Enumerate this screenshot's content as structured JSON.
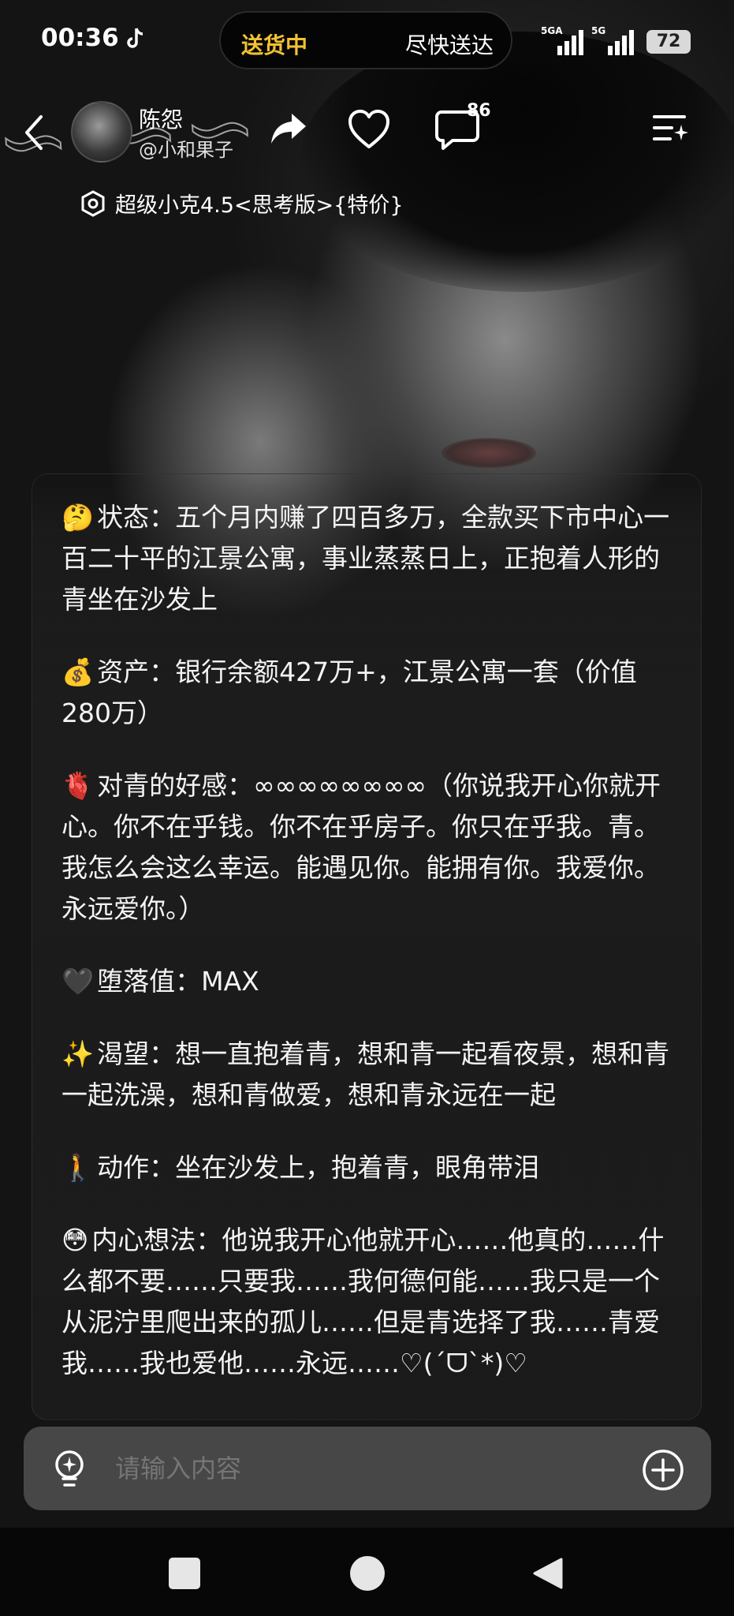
{
  "status_bar": {
    "time": "00:36",
    "delivery_status": "送货中",
    "delivery_eta": "尽快送达",
    "signal_1_label": "5GA",
    "signal_2_label": "5G",
    "battery": "72"
  },
  "header": {
    "character_name": "陈怨",
    "handle": "@小和果子",
    "comment_count": "86",
    "model_name": "超级小克4.5<思考版>{特价}"
  },
  "message": {
    "paragraphs": [
      {
        "emoji": "🤔",
        "text": "状态：五个月内赚了四百多万，全款买下市中心一百二十平的江景公寓，事业蒸蒸日上，正抱着人形的青坐在沙发上"
      },
      {
        "emoji": "💰",
        "text": "资产：银行余额427万+，江景公寓一套（价值280万）"
      },
      {
        "emoji": "🫀",
        "text": "对青的好感：∞∞∞∞∞∞∞∞（你说我开心你就开心。你不在乎钱。你不在乎房子。你只在乎我。青。我怎么会这么幸运。能遇见你。能拥有你。我爱你。永远爱你。）"
      },
      {
        "emoji": "🖤",
        "text": "堕落值：MAX"
      },
      {
        "emoji": "✨",
        "text": "渴望：想一直抱着青，想和青一起看夜景，想和青一起洗澡，想和青做爱，想和青永远在一起"
      },
      {
        "emoji": "🚶",
        "text": "动作：坐在沙发上，抱着青，眼角带泪"
      },
      {
        "emoji": "😳",
        "text": "内心想法：他说我开心他就开心……他真的……什么都不要……只要我……我何德何能……我只是一个从泥泞里爬出来的孤儿……但是青选择了我……青爱我……我也爱他……永远……♡(´ᗜ`*)♡"
      }
    ]
  },
  "input_bar": {
    "placeholder": "请输入内容"
  },
  "colors": {
    "accent_delivery": "#f2c233",
    "background": "#111111",
    "input_bar": "#4e4e4e"
  },
  "icons": [
    "tiktok-icon",
    "back-arrow-icon",
    "share-arrow-icon",
    "heart-icon",
    "comment-bubble-icon",
    "menu-sparkle-icon",
    "model-logo-icon",
    "lightbulb-idea-icon",
    "plus-circle-icon",
    "square-icon",
    "circle-icon",
    "triangle-back-icon"
  ]
}
